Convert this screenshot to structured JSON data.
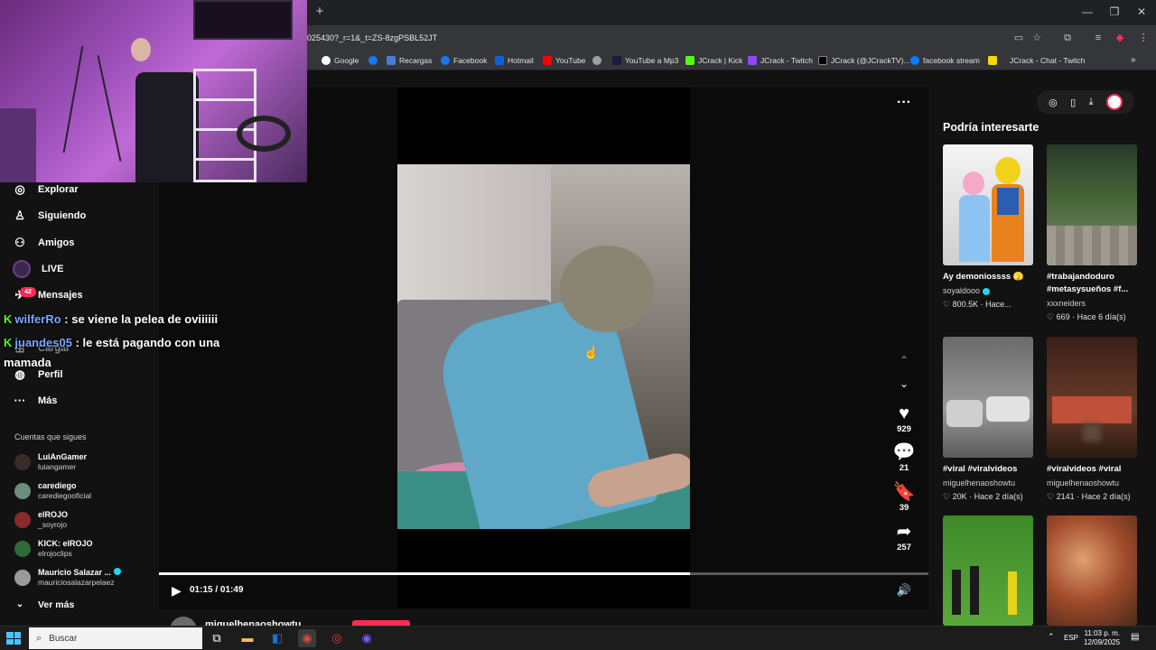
{
  "browser": {
    "url": "025430?_r=1&_t=ZS-8zgPSBL52JT",
    "newtab": "+",
    "bookmarks": [
      {
        "label": "Google",
        "icon": "google-icon"
      },
      {
        "label": "",
        "icon": "facebook-icon"
      },
      {
        "label": "Recargas",
        "icon": "recargas-icon"
      },
      {
        "label": "Facebook",
        "icon": "facebook-icon"
      },
      {
        "label": "Hotmail",
        "icon": "hotmail-icon"
      },
      {
        "label": "YouTube",
        "icon": "youtube-icon"
      },
      {
        "label": "",
        "icon": "globe-icon"
      },
      {
        "label": "YouTube a Mp3",
        "icon": "mp3-icon"
      },
      {
        "label": "JCrack | Kick",
        "icon": "kick-icon"
      },
      {
        "label": "JCrack - Twitch",
        "icon": "twitch-icon"
      },
      {
        "label": "JCrack (@JCrackTV)...",
        "icon": "x-icon"
      },
      {
        "label": "facebook stream",
        "icon": "meta-icon"
      },
      {
        "label": "JCrack - Chat - Twitch",
        "icon": "twitch-icon"
      }
    ]
  },
  "sidebar": {
    "nav": [
      {
        "label": "Explorar",
        "icon": "compass-icon"
      },
      {
        "label": "Siguiendo",
        "icon": "person-icon"
      },
      {
        "label": "Amigos",
        "icon": "friends-icon"
      },
      {
        "label": "LIVE",
        "icon": "live-icon"
      },
      {
        "label": "Mensajes",
        "icon": "messages-icon"
      },
      {
        "label": "Cargar",
        "icon": "upload-icon"
      },
      {
        "label": "Perfil",
        "icon": "profile-icon"
      },
      {
        "label": "Más",
        "icon": "more-icon"
      }
    ],
    "messages_badge": "42",
    "following_title": "Cuentas que sigues",
    "accounts": [
      {
        "name": "LuiAnGamer",
        "handle": "luiangamer"
      },
      {
        "name": "carediego",
        "handle": "carediegooficial"
      },
      {
        "name": "elROJO",
        "handle": "_soyrojo"
      },
      {
        "name": "KICK: elROJO",
        "handle": "elrojoclips"
      },
      {
        "name": "Mauricio Salazar ...",
        "handle": "mauriciosalazarpelaez"
      }
    ],
    "see_more": "Ver más"
  },
  "chat": [
    {
      "user": "wilferRo",
      "text": " : se viene la pelea de oviiiiii"
    },
    {
      "user": "juandes05",
      "text": " : le está pagando con una"
    },
    {
      "user": "",
      "text": "mamada"
    }
  ],
  "player": {
    "likes": "929",
    "comments": "21",
    "saves": "39",
    "shares": "257",
    "progress": 0.69,
    "time": "01:15 / 01:49",
    "author": "miguelhenaoshowtu"
  },
  "recommended": {
    "title": "Podría interesarte",
    "cards": [
      {
        "title": "Ay demoniossss 🫣",
        "user": "soyaldooo",
        "verified": true,
        "meta": "♡ 800.5K · Hace..."
      },
      {
        "title": "#trabajandoduro #metasysueños #f...",
        "user": "xxxneiders",
        "verified": false,
        "meta": "♡ 669 · Hace 6 día(s)"
      },
      {
        "title": "#viral #viralvideos",
        "user": "miguelhenaoshowtu",
        "verified": false,
        "meta": "♡ 20K · Hace 2 día(s)"
      },
      {
        "title": "#viralvideos #viral",
        "user": "miguelhenaoshowtu",
        "verified": false,
        "meta": "♡ 2141 · Hace 2 día(s)"
      },
      {
        "title": "",
        "user": "",
        "verified": false,
        "meta": ""
      },
      {
        "title": "",
        "user": "",
        "verified": false,
        "meta": ""
      }
    ]
  },
  "taskbar": {
    "search_placeholder": "Buscar",
    "lang": "ESP",
    "time": "11:03 p. m.",
    "date": "12/09/2025"
  },
  "colors": {
    "accent": "#fe2c55",
    "kick": "#53fc18"
  }
}
